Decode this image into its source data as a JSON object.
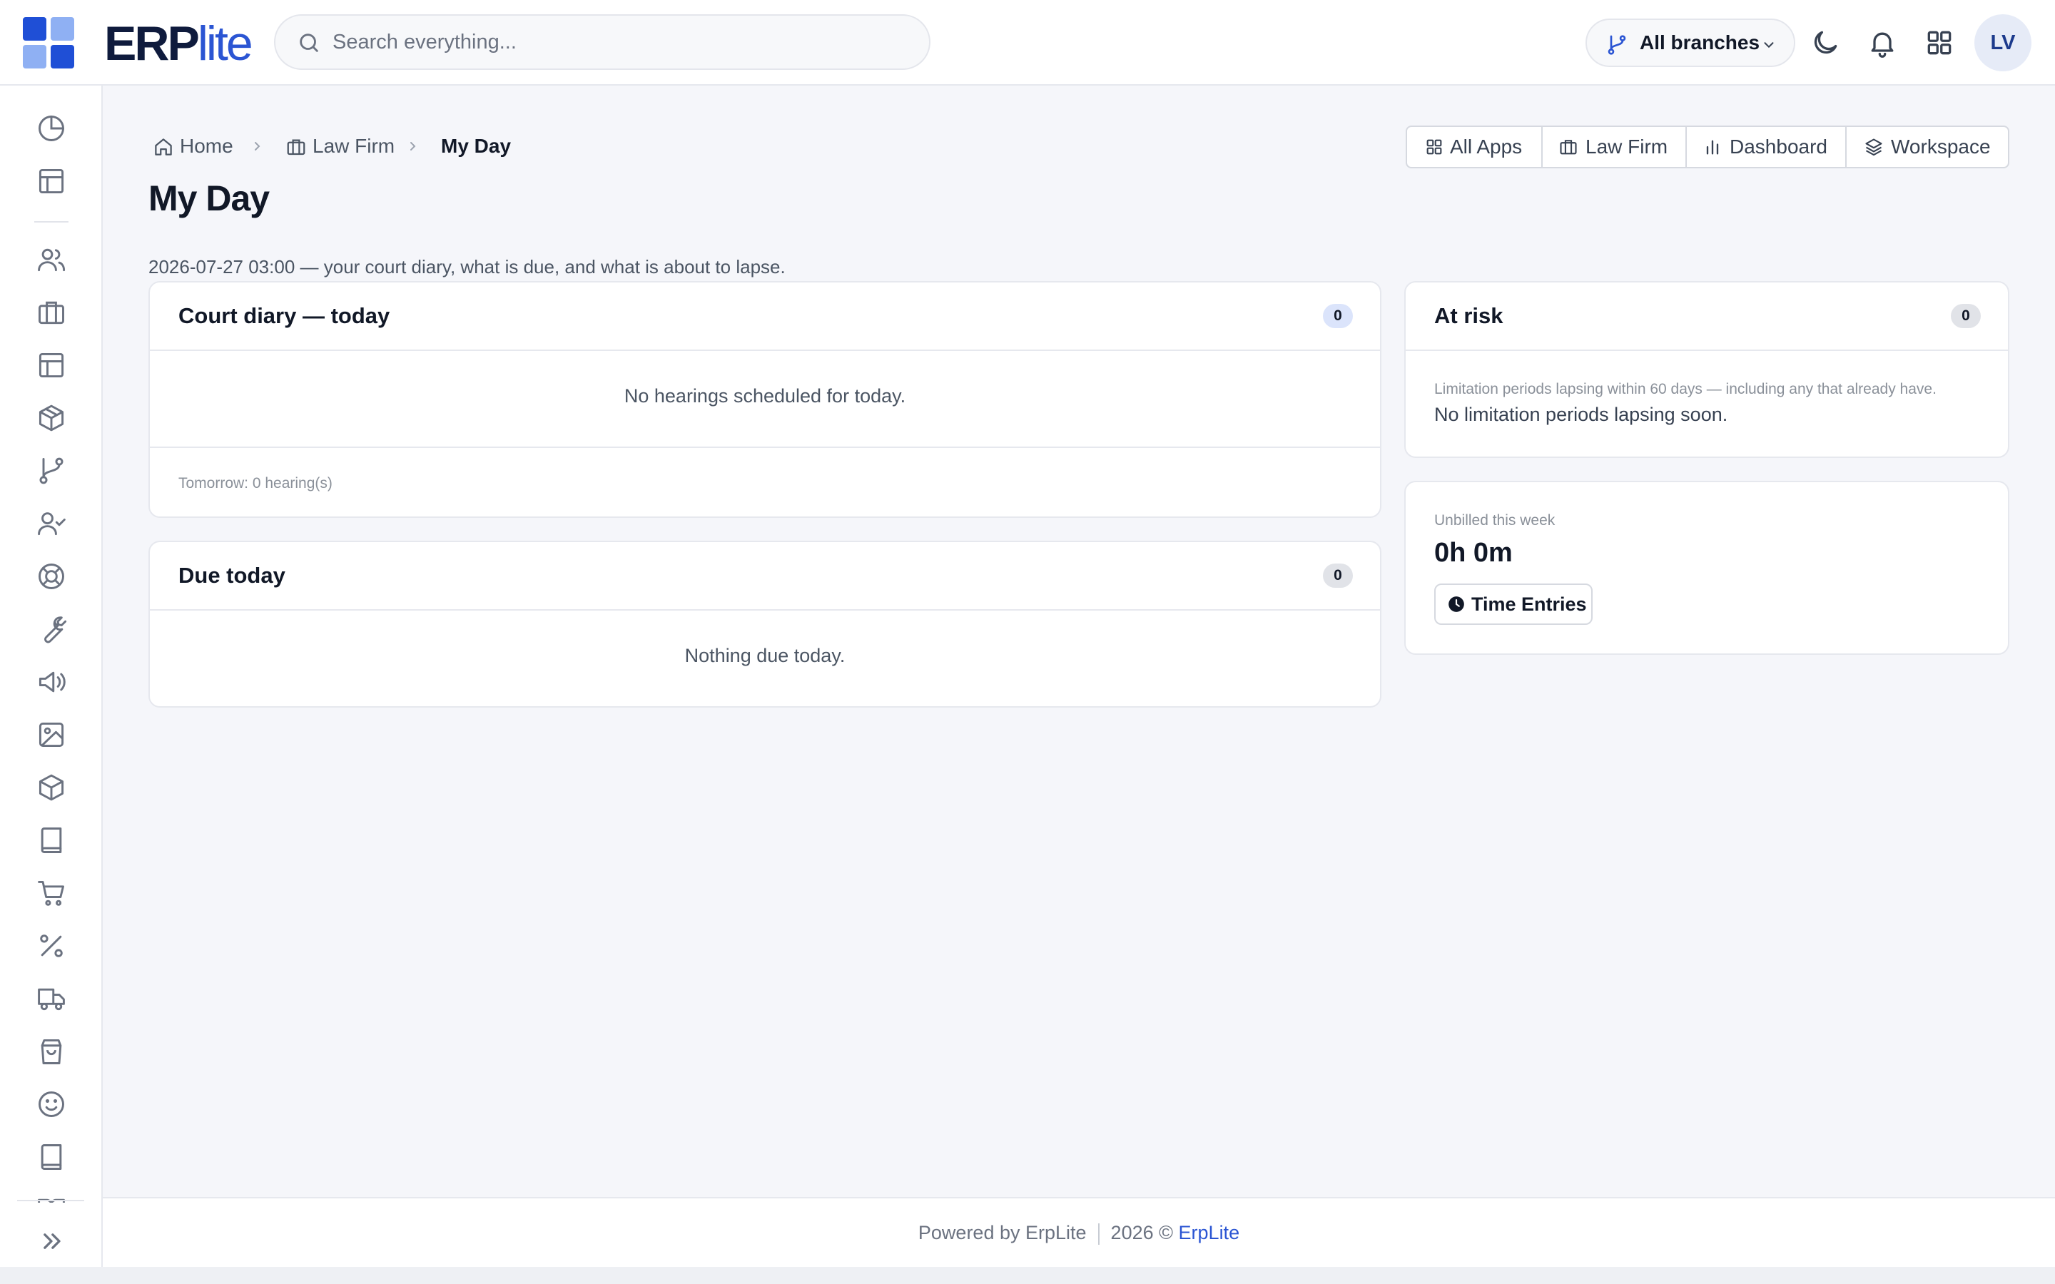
{
  "app": {
    "logo_erp": "ERP",
    "logo_lite": "lite"
  },
  "search": {
    "placeholder": "Search everything..."
  },
  "header": {
    "branch_label": "All branches",
    "avatar_initials": "LV"
  },
  "sidebar": {
    "icons": [
      "pie-chart-icon",
      "layout-icon",
      "users-icon",
      "briefcase-icon",
      "layout-icon",
      "package-icon",
      "git-branch-icon",
      "user-check-icon",
      "life-buoy-icon",
      "wrench-icon",
      "megaphone-icon",
      "image-icon",
      "box-icon",
      "book-icon",
      "cart-icon",
      "percent-icon",
      "truck-icon",
      "shopping-bag-icon",
      "smile-icon",
      "book-icon"
    ],
    "expand_icon": "chevrons-right-icon"
  },
  "breadcrumb": {
    "home": "Home",
    "section": "Law Firm",
    "current": "My Day"
  },
  "quick_links": [
    "All Apps",
    "Law Firm",
    "Dashboard",
    "Workspace"
  ],
  "page": {
    "title": "My Day",
    "subtitle": "2026-07-27 03:00 — your court diary, what is due, and what is about to lapse."
  },
  "court_diary": {
    "title": "Court diary — today",
    "count": "0",
    "empty": "No hearings scheduled for today.",
    "tomorrow": "Tomorrow: 0 hearing(s)"
  },
  "due_today": {
    "title": "Due today",
    "count": "0",
    "empty": "Nothing due today."
  },
  "at_risk": {
    "title": "At risk",
    "count": "0",
    "note": "Limitation periods lapsing within 60 days — including any that already have.",
    "empty": "No limitation periods lapsing soon."
  },
  "unbilled": {
    "label": "Unbilled this week",
    "value": "0h 0m",
    "button": "Time Entries"
  },
  "footer": {
    "powered": "Powered by ErpLite",
    "year": "2026 ©",
    "brand": "ErpLite"
  },
  "colors": {
    "accent": "#2b55d3",
    "logo_dark": "#0f1b3d",
    "background": "#f5f6fa"
  }
}
